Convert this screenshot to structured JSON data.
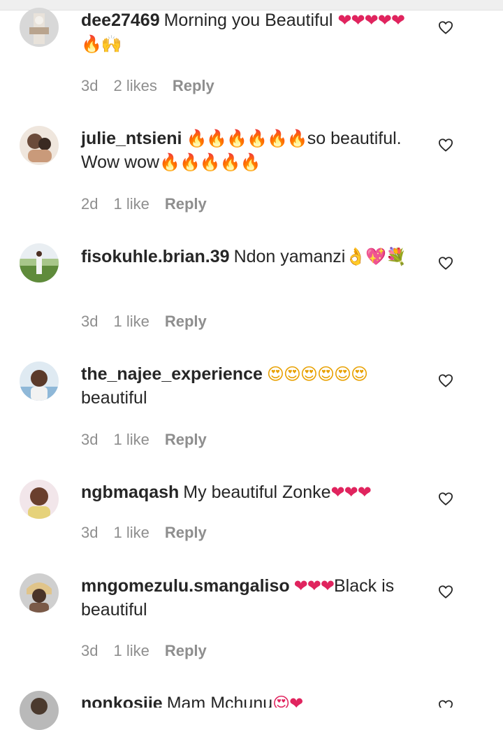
{
  "comments": [
    {
      "username": "dee27469",
      "text": "Morning you Beautiful",
      "emoji": "❤❤❤❤❤🔥🙌",
      "time": "3d",
      "likes": "2 likes",
      "reply": "Reply",
      "avatar_colors": [
        "#d8d8d8",
        "#b9a48e",
        "#e8e2da"
      ]
    },
    {
      "username": "julie_ntsieni",
      "text": "so beautiful. Wow wow",
      "emoji_a": "🔥🔥🔥🔥🔥🔥",
      "emoji_b": "🔥🔥🔥🔥🔥",
      "time": "2d",
      "likes": "1 like",
      "reply": "Reply",
      "avatar_colors": [
        "#efe6dd",
        "#6b4b3a",
        "#c99a7a"
      ]
    },
    {
      "username": "fisokuhle.brian.39",
      "text": "Ndon yamanzi",
      "emoji": "👌💖💐",
      "time": "3d",
      "likes": "1 like",
      "reply": "Reply",
      "avatar_colors": [
        "#5f8b3b",
        "#a8c68a",
        "#e9eef2"
      ]
    },
    {
      "username": "the_najee_experience",
      "text": "beautiful",
      "emoji": "😍😍😍😍😍😍",
      "time": "3d",
      "likes": "1 like",
      "reply": "Reply",
      "avatar_colors": [
        "#8fb8d8",
        "#5b3a2a",
        "#dfeaf2"
      ]
    },
    {
      "username": "ngbmaqash",
      "text": "My beautiful Zonke",
      "emoji": "❤❤❤",
      "time": "3d",
      "likes": "1 like",
      "reply": "Reply",
      "avatar_colors": [
        "#f2e6ea",
        "#6a3f2e",
        "#e6d27a"
      ]
    },
    {
      "username": "mngomezulu.smangaliso",
      "text": "Black is beautiful",
      "emoji": "❤❤❤",
      "time": "3d",
      "likes": "1 like",
      "reply": "Reply",
      "avatar_colors": [
        "#cfcfcf",
        "#4a3328",
        "#e0c48a"
      ]
    },
    {
      "username": "nonkosiie",
      "text": "Mam Mchunu",
      "emoji": "😍❤",
      "avatar_colors": [
        "#b9b9b9",
        "#4b3a2e",
        "#d8d8d8"
      ]
    }
  ],
  "icons": {
    "like": "heart-outline-icon"
  },
  "colors": {
    "text": "#262626",
    "meta": "#8e8e8e",
    "heart_emoji": "#e0245e",
    "fire_emoji": "#ff6a00"
  }
}
